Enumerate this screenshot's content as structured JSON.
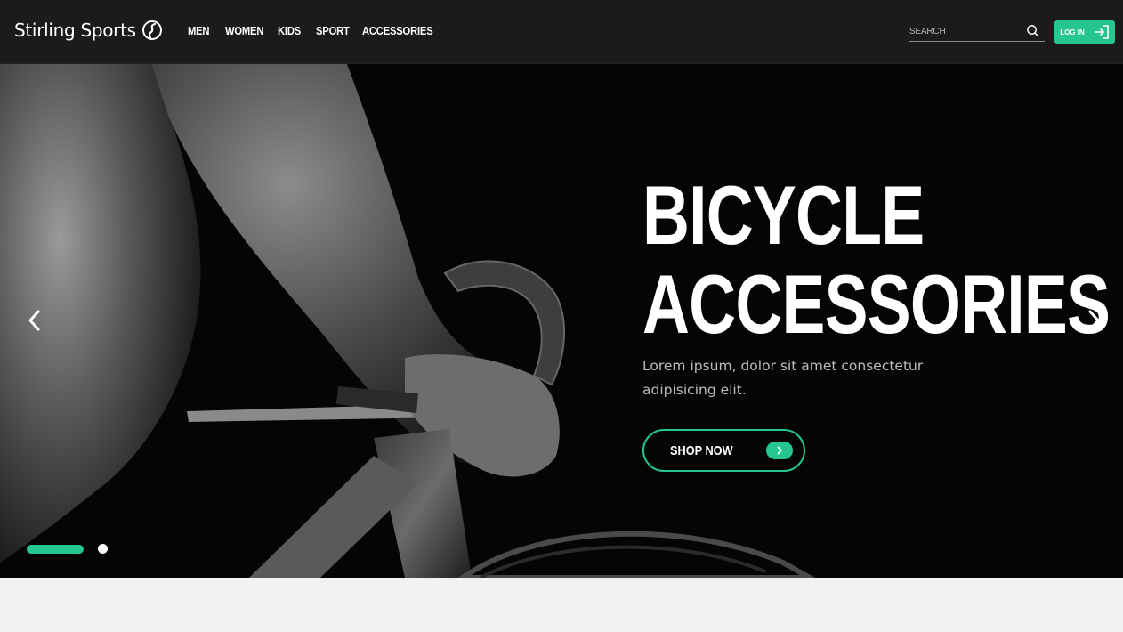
{
  "brand": {
    "name": "Stirling Sports",
    "logo_icon": "swirl-s-icon",
    "accent_color": "#25c78f"
  },
  "nav": {
    "items": [
      "MEN",
      "WOMEN",
      "KIDS",
      "SPORT",
      "ACCESSORIES"
    ]
  },
  "search": {
    "placeholder": "SEARCH",
    "icon": "search-icon"
  },
  "login": {
    "label": "LOG IN",
    "icon": "login-arrow-icon"
  },
  "hero": {
    "title_line1": "BICYCLE",
    "title_line2": "ACCESSORIES",
    "description": "Lorem ipsum, dolor sit amet consectetur adipisicing elit.",
    "cta_label": "SHOP NOW",
    "cta_icon": "chevron-right-icon",
    "prev_icon": "chevron-left-icon",
    "next_icon": "chevron-right-icon",
    "slides": {
      "total": 2,
      "active": 1
    }
  }
}
